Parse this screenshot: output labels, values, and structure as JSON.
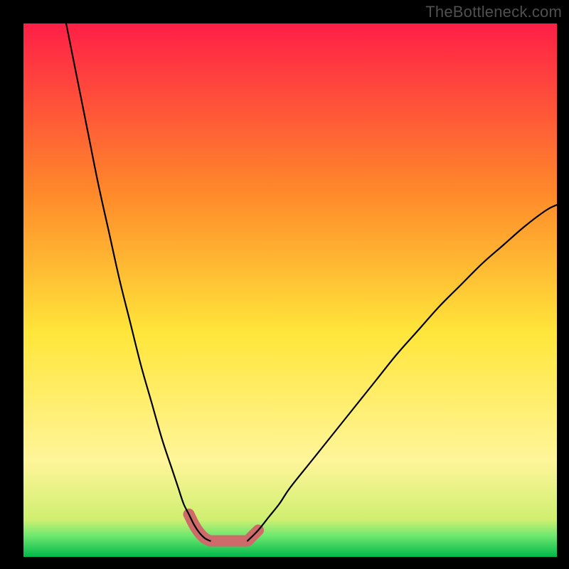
{
  "watermark": "TheBottleneck.com",
  "colors": {
    "background": "#000000",
    "gradient_top": "#ff1f47",
    "gradient_upper_mid": "#ff8a2a",
    "gradient_mid": "#ffe63a",
    "gradient_lower_mid": "#fff59a",
    "gradient_green_start": "#6fe86f",
    "gradient_bottom": "#00b84a",
    "curve": "#000000",
    "band": "#cf6a6a"
  },
  "chart_data": {
    "type": "line",
    "title": "",
    "xlabel": "",
    "ylabel": "",
    "xlim": [
      0,
      100
    ],
    "ylim": [
      0,
      100
    ],
    "grid": false,
    "legend": false,
    "notes": "V-shaped bottleneck curve on red-yellow-green vertical gradient. Lower y = better (green zone near bottom). Short thick salmon band highlights valley segment near y≈3.",
    "series": [
      {
        "name": "bottleneck-curve-left",
        "x": [
          8,
          10,
          12,
          14,
          16,
          18,
          20,
          22,
          24,
          26,
          28,
          29,
          30,
          31,
          32,
          33,
          34,
          35
        ],
        "y": [
          100,
          90,
          80,
          70,
          61,
          52,
          44,
          36,
          29,
          22,
          16,
          13,
          10,
          8,
          6,
          4.5,
          3.5,
          3
        ]
      },
      {
        "name": "bottleneck-curve-right",
        "x": [
          42,
          44,
          46,
          48,
          50,
          54,
          58,
          62,
          66,
          70,
          74,
          78,
          82,
          86,
          90,
          94,
          98,
          100
        ],
        "y": [
          3,
          5,
          7.5,
          10,
          13,
          18,
          23,
          28,
          33,
          38,
          42.5,
          47,
          51,
          55,
          58.5,
          62,
          65,
          66
        ]
      },
      {
        "name": "valley-highlight-band",
        "x": [
          31,
          32,
          33,
          34,
          35,
          42,
          43,
          44
        ],
        "y": [
          8,
          6,
          4.5,
          3.5,
          3,
          3,
          4,
          5
        ]
      }
    ],
    "valley": {
      "x_range": [
        35,
        42
      ],
      "y": 3
    }
  }
}
